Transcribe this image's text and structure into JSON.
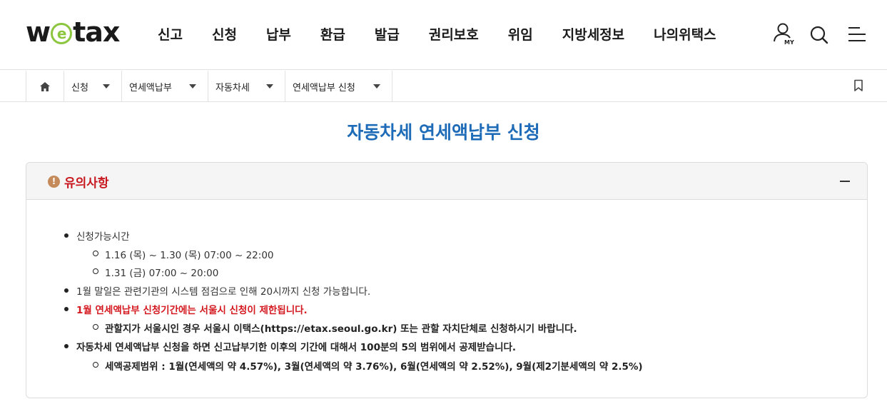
{
  "header": {
    "logo": {
      "pre": "w",
      "circle": "e",
      "post": "tax"
    },
    "nav": [
      "신고",
      "신청",
      "납부",
      "환급",
      "발급",
      "권리보호",
      "위임",
      "지방세정보",
      "나의위택스"
    ],
    "util": {
      "my_label": "MY"
    }
  },
  "breadcrumb": {
    "items": [
      "신청",
      "연세액납부",
      "자동차세",
      "연세액납부 신청"
    ]
  },
  "page": {
    "title": "자동차세 연세액납부 신청"
  },
  "notice": {
    "title": "유의사항",
    "rows": [
      {
        "text": "신청가능시간"
      },
      {
        "text": "1.16 (목) ~ 1.30 (목) 07:00 ~ 22:00"
      },
      {
        "text": "1.31 (금) 07:00 ~ 20:00"
      },
      {
        "text": "1월 말일은 관련기관의 시스템 점검으로 인해 20시까지 신청 가능합니다."
      },
      {
        "text": "1월 연세액납부 신청기간에는 서울시 신청이 제한됩니다."
      },
      {
        "text": "관할지가 서울시인 경우 서울시 이택스(https://etax.seoul.go.kr) 또는 관할 자치단체로 신청하시기 바랍니다."
      },
      {
        "text": "자동차세 연세액납부 신청을 하면 신고납부기한 이후의 기간에 대해서 100분의 5의 범위에서 공제받습니다."
      },
      {
        "text": "세액공제범위 : 1월(연세액의 약 4.57%), 3월(연세액의 약 3.76%), 6월(연세액의 약 2.52%), 9월(제2기분세액의 약 2.5%)"
      }
    ]
  }
}
